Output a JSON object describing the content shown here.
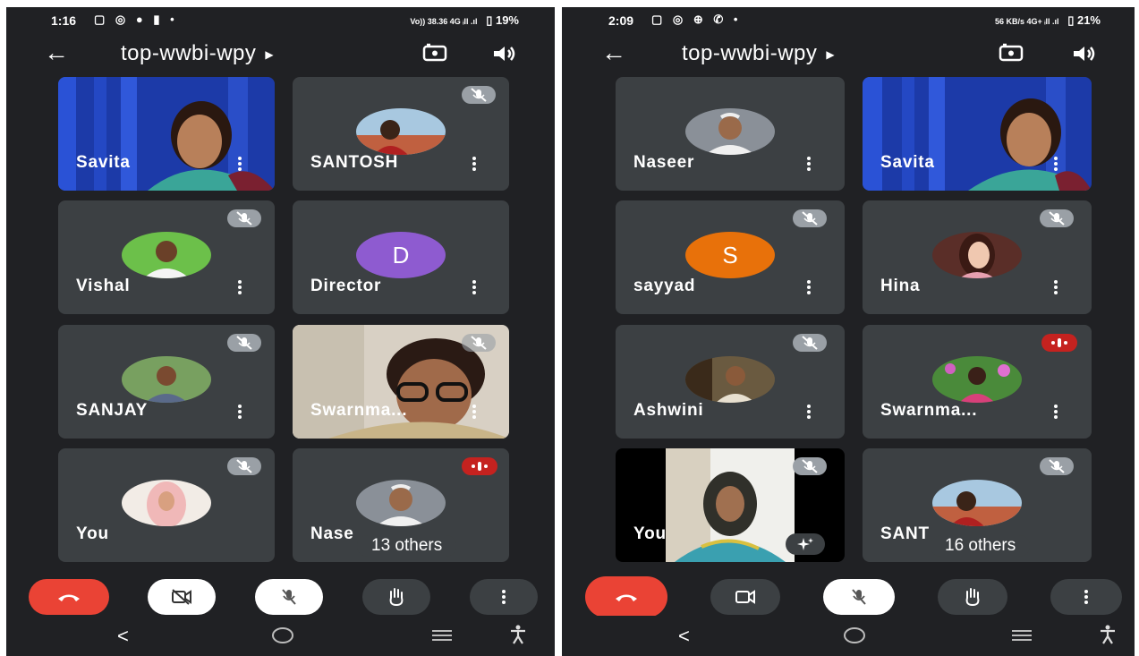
{
  "screens": [
    {
      "status": {
        "time": "1:16",
        "icons": "▢ ◎ ● ▮ •",
        "network": "Vo)) 38.36 4G ᵢll .ıl",
        "battery": "19%"
      },
      "meeting_title": "top-wwbi-wpy",
      "tiles": [
        {
          "name": "Savita",
          "kind": "video"
        },
        {
          "name": "SANTOSH",
          "kind": "photo",
          "muted": true
        },
        {
          "name": "Vishal",
          "kind": "photo",
          "muted": true
        },
        {
          "name": "Director",
          "kind": "letter",
          "letter": "D",
          "avatar_color": "#8e5bd0"
        },
        {
          "name": "SANJAY",
          "kind": "photo",
          "muted": true
        },
        {
          "name": "Swarnma...",
          "kind": "video",
          "muted": true
        },
        {
          "name": "You",
          "kind": "photo",
          "muted": true
        },
        {
          "name": "Nase",
          "kind": "photo",
          "speaking": true
        }
      ],
      "others_label": "13 others"
    },
    {
      "status": {
        "time": "2:09",
        "icons": "▢ ◎ ⊕ ✆ •",
        "network": "56 KB/s 4G+ ᵢll .ıl",
        "battery": "21%"
      },
      "meeting_title": "top-wwbi-wpy",
      "tiles": [
        {
          "name": "Naseer",
          "kind": "photo"
        },
        {
          "name": "Savita",
          "kind": "video"
        },
        {
          "name": "sayyad",
          "kind": "letter",
          "letter": "S",
          "avatar_color": "#e8710a",
          "muted": true
        },
        {
          "name": "Hina",
          "kind": "photo",
          "muted": true
        },
        {
          "name": "Ashwini",
          "kind": "photo",
          "muted": true
        },
        {
          "name": "Swarnma...",
          "kind": "photo",
          "speaking": true
        },
        {
          "name": "You",
          "kind": "video",
          "muted": true
        },
        {
          "name": "SANT",
          "kind": "photo",
          "muted": true
        }
      ],
      "others_label": "16 others"
    }
  ],
  "colors": {
    "background": "#202124",
    "tile": "#3c4043",
    "end_call": "#ea4335",
    "speaking": "#c5221f",
    "muted_badge": "#9aa0a6"
  },
  "icons": [
    "back-arrow-icon",
    "camera-switch-icon",
    "speaker-icon",
    "mic-off-icon",
    "more-vert-icon",
    "end-call-icon",
    "camera-off-icon",
    "camera-icon",
    "raise-hand-icon",
    "sparkle-effects-icon"
  ]
}
